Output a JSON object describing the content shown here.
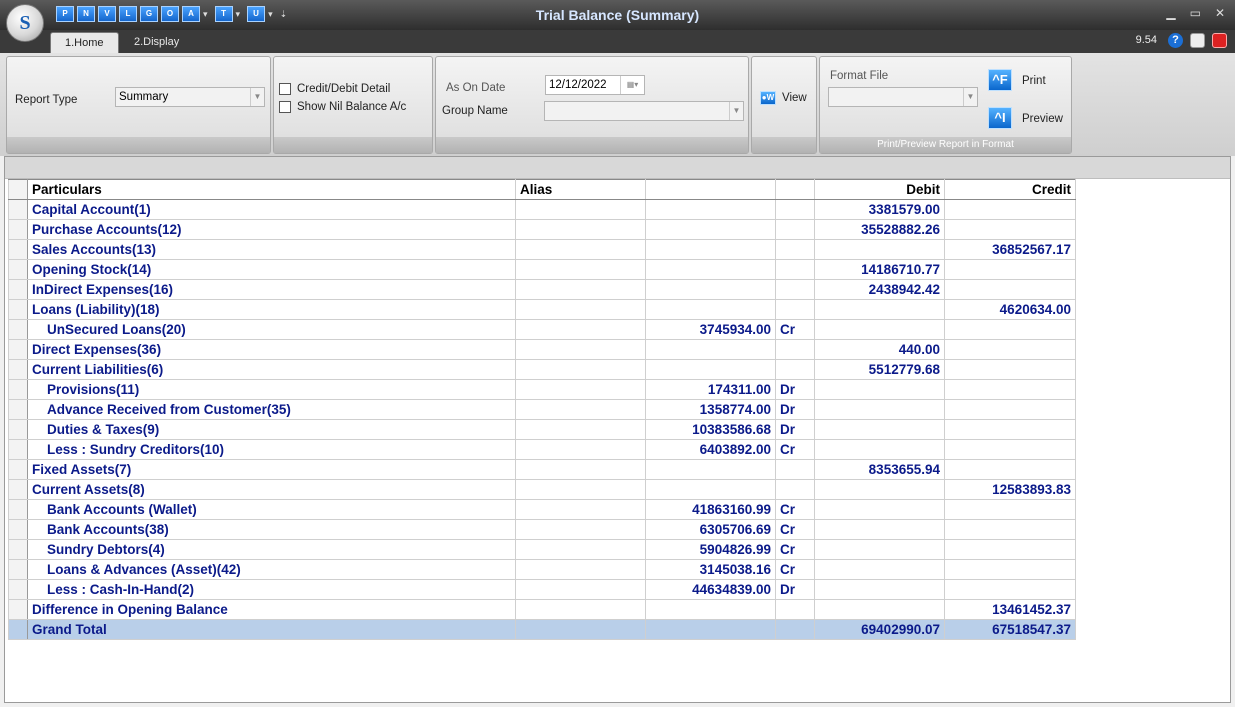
{
  "window": {
    "title": "Trial Balance (Summary)",
    "logo_text": "S",
    "quick_access": [
      "P",
      "N",
      "V",
      "L",
      "G",
      "O",
      "A",
      "T",
      "U"
    ]
  },
  "tabs": [
    {
      "label": "1.Home"
    },
    {
      "label": "2.Display"
    }
  ],
  "version": "9.54",
  "ribbon": {
    "report_type_label": "Report Type",
    "report_type_value": "Summary",
    "credit_debit_detail_label": "Credit/Debit Detail",
    "show_nil_balance_label": "Show Nil Balance A/c",
    "as_on_date_label": "As On Date",
    "as_on_date_value": "12/12/2022",
    "group_name_label": "Group Name",
    "group_name_value": "",
    "view_label": "View",
    "format_file_label": "Format File",
    "format_file_value": "",
    "print_label": "Print",
    "preview_label": "Preview",
    "print_group_caption": "Print/Preview Report in Format"
  },
  "table": {
    "headers": {
      "particulars": "Particulars",
      "alias": "Alias",
      "amount": "",
      "type": "",
      "debit": "Debit",
      "credit": "Credit"
    },
    "rows": [
      {
        "particulars": "Capital Account(1)",
        "alias": "",
        "amount": "",
        "type": "",
        "debit": "3381579.00",
        "credit": "",
        "indent": false
      },
      {
        "particulars": "Purchase Accounts(12)",
        "alias": "",
        "amount": "",
        "type": "",
        "debit": "35528882.26",
        "credit": "",
        "indent": false
      },
      {
        "particulars": "Sales Accounts(13)",
        "alias": "",
        "amount": "",
        "type": "",
        "debit": "",
        "credit": "36852567.17",
        "indent": false
      },
      {
        "particulars": "Opening Stock(14)",
        "alias": "",
        "amount": "",
        "type": "",
        "debit": "14186710.77",
        "credit": "",
        "indent": false
      },
      {
        "particulars": "InDirect Expenses(16)",
        "alias": "",
        "amount": "",
        "type": "",
        "debit": "2438942.42",
        "credit": "",
        "indent": false
      },
      {
        "particulars": "Loans (Liability)(18)",
        "alias": "",
        "amount": "",
        "type": "",
        "debit": "",
        "credit": "4620634.00",
        "indent": false
      },
      {
        "particulars": "UnSecured Loans(20)",
        "alias": "",
        "amount": "3745934.00",
        "type": "Cr",
        "debit": "",
        "credit": "",
        "indent": true
      },
      {
        "particulars": "Direct Expenses(36)",
        "alias": "",
        "amount": "",
        "type": "",
        "debit": "440.00",
        "credit": "",
        "indent": false
      },
      {
        "particulars": "Current Liabilities(6)",
        "alias": "",
        "amount": "",
        "type": "",
        "debit": "5512779.68",
        "credit": "",
        "indent": false
      },
      {
        "particulars": "Provisions(11)",
        "alias": "",
        "amount": "174311.00",
        "type": "Dr",
        "debit": "",
        "credit": "",
        "indent": true
      },
      {
        "particulars": "Advance Received from Customer(35)",
        "alias": "",
        "amount": "1358774.00",
        "type": "Dr",
        "debit": "",
        "credit": "",
        "indent": true
      },
      {
        "particulars": "Duties & Taxes(9)",
        "alias": "",
        "amount": "10383586.68",
        "type": "Dr",
        "debit": "",
        "credit": "",
        "indent": true
      },
      {
        "particulars": "Less : Sundry Creditors(10)",
        "alias": "",
        "amount": "6403892.00",
        "type": "Cr",
        "debit": "",
        "credit": "",
        "indent": true
      },
      {
        "particulars": "Fixed Assets(7)",
        "alias": "",
        "amount": "",
        "type": "",
        "debit": "8353655.94",
        "credit": "",
        "indent": false
      },
      {
        "particulars": "Current Assets(8)",
        "alias": "",
        "amount": "",
        "type": "",
        "debit": "",
        "credit": "12583893.83",
        "indent": false
      },
      {
        "particulars": "Bank Accounts (Wallet)",
        "alias": "",
        "amount": "41863160.99",
        "type": "Cr",
        "debit": "",
        "credit": "",
        "indent": true
      },
      {
        "particulars": "Bank Accounts(38)",
        "alias": "",
        "amount": "6305706.69",
        "type": "Cr",
        "debit": "",
        "credit": "",
        "indent": true
      },
      {
        "particulars": "Sundry Debtors(4)",
        "alias": "",
        "amount": "5904826.99",
        "type": "Cr",
        "debit": "",
        "credit": "",
        "indent": true
      },
      {
        "particulars": "Loans & Advances (Asset)(42)",
        "alias": "",
        "amount": "3145038.16",
        "type": "Cr",
        "debit": "",
        "credit": "",
        "indent": true
      },
      {
        "particulars": "Less : Cash-In-Hand(2)",
        "alias": "",
        "amount": "44634839.00",
        "type": "Dr",
        "debit": "",
        "credit": "",
        "indent": true
      },
      {
        "particulars": "Difference in Opening Balance",
        "alias": "",
        "amount": "",
        "type": "",
        "debit": "",
        "credit": "13461452.37",
        "indent": false
      }
    ],
    "total": {
      "particulars": "Grand Total",
      "debit": "69402990.07",
      "credit": "67518547.37"
    }
  },
  "colors": {
    "row_text": "#0b1a8a",
    "total_row_bg": "#b9cfe9"
  }
}
